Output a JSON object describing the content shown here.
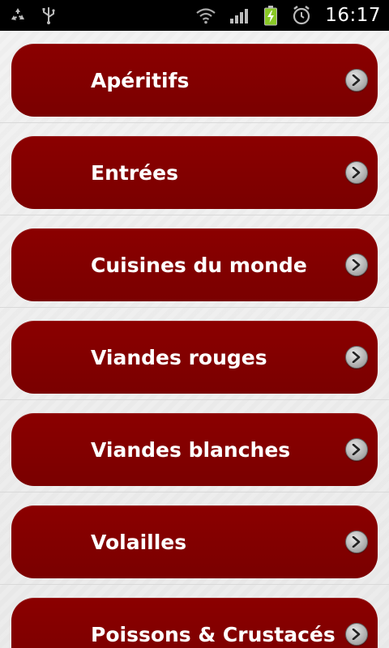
{
  "status_bar": {
    "time": "16:17",
    "left_icons": [
      "recycle-icon",
      "usb-icon"
    ],
    "right_icons": [
      "wifi-icon",
      "signal-icon",
      "battery-charging-icon",
      "alarm-clock-icon"
    ]
  },
  "menu": {
    "items": [
      {
        "label": "Apéritifs"
      },
      {
        "label": "Entrées"
      },
      {
        "label": "Cuisines du monde"
      },
      {
        "label": "Viandes rouges"
      },
      {
        "label": "Viandes blanches"
      },
      {
        "label": "Volailles"
      },
      {
        "label": "Poissons & Crustacés"
      }
    ],
    "item_icon": "chevron-right-icon"
  },
  "colors": {
    "button_red": "#8b0000",
    "text_white": "#ffffff",
    "status_bar": "#000000",
    "battery_green": "#8ac926"
  }
}
